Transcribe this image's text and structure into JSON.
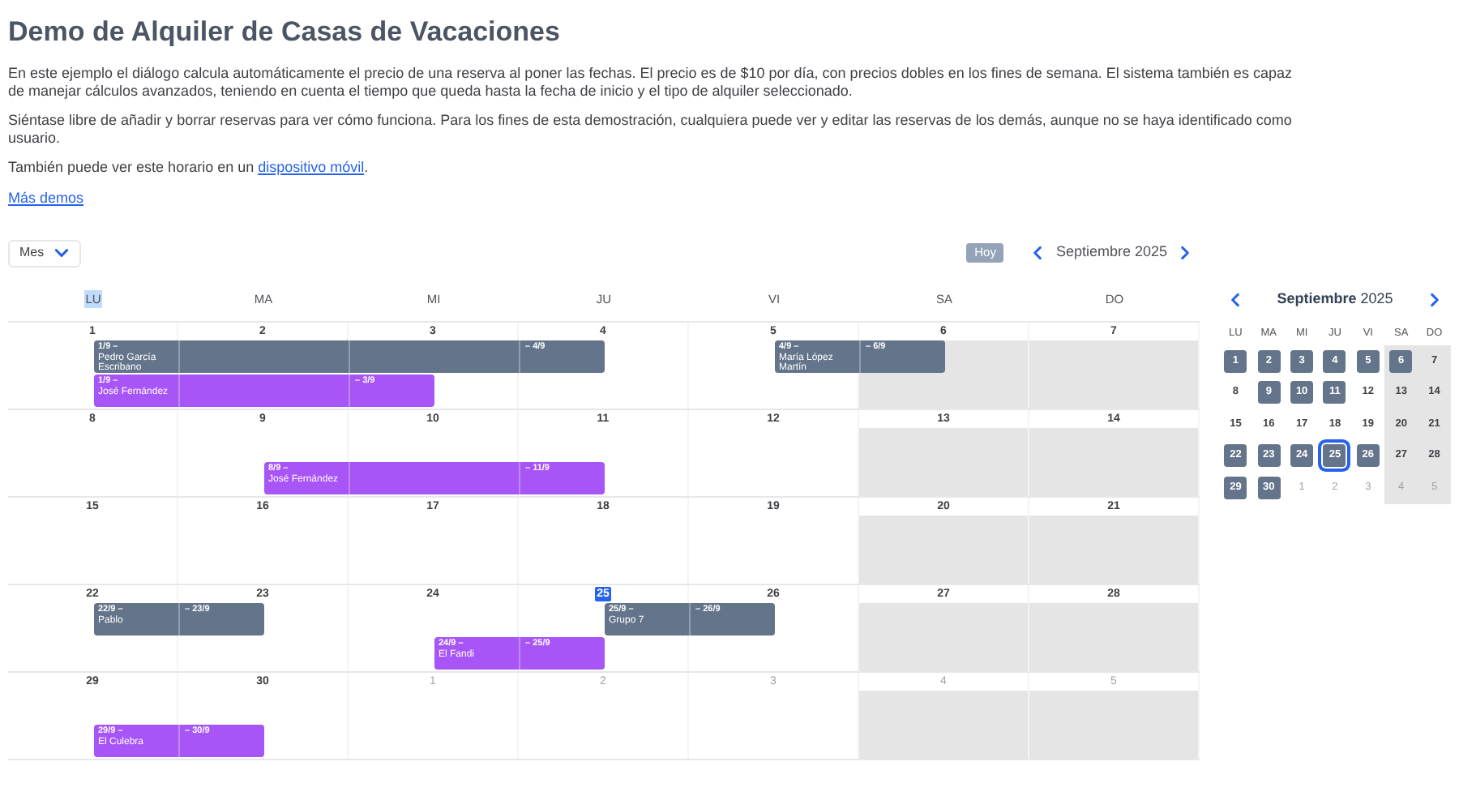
{
  "title": "Demo de Alquiler de Casas de Vacaciones",
  "paragraphs": [
    "En este ejemplo el diálogo calcula automáticamente el precio de una reserva al poner las fechas. El precio es de $10 por día, con precios dobles en los fines de semana. El sistema también es capaz de manejar cálculos avanzados, teniendo en cuenta el tiempo que queda hasta la fecha de inicio y el tipo de alquiler seleccionado.",
    "Siéntase libre de añadir y borrar reservas para ver cómo funciona. Para los fines de esta demostración, cualquiera puede ver y editar las reservas de los demás, aunque no se haya identificado como usuario."
  ],
  "mobile_note": {
    "text": "También puede ver este horario en un ",
    "link": "dispositivo móvil",
    "after": "."
  },
  "more_link": "Más demos",
  "toolbar": {
    "view": "Mes",
    "today": "Hoy",
    "month": "Septiembre 2025"
  },
  "weekdays": [
    {
      "label": "LU",
      "highlighted": true
    },
    {
      "label": "MA",
      "highlighted": false
    },
    {
      "label": "MI",
      "highlighted": false
    },
    {
      "label": "JU",
      "highlighted": false
    },
    {
      "label": "VI",
      "highlighted": false
    },
    {
      "label": "SA",
      "highlighted": false
    },
    {
      "label": "DO",
      "highlighted": false
    }
  ],
  "weeks": [
    {
      "days": [
        {
          "label": "1",
          "muted": false,
          "today": false
        },
        {
          "label": "2",
          "muted": false,
          "today": false
        },
        {
          "label": "3",
          "muted": false,
          "today": false
        },
        {
          "label": "4",
          "muted": false,
          "today": false
        },
        {
          "label": "5",
          "muted": false,
          "today": false
        },
        {
          "label": "6",
          "muted": false,
          "today": false
        },
        {
          "label": "7",
          "muted": false,
          "today": false
        }
      ],
      "lanes": [
        {
          "slots": [
            {
              "kind": "start",
              "date": "1/9 –",
              "name": "Pedro García Escribano",
              "color": "#64748b"
            },
            {
              "kind": "middle"
            },
            {
              "kind": "middle"
            },
            {
              "kind": "end",
              "date": "– 4/9"
            },
            {
              "kind": "start",
              "date": "4/9 –",
              "name": "María López Martín",
              "color": "#64748b"
            },
            {
              "kind": "end",
              "date": "– 6/9"
            },
            {
              "kind": "empty"
            }
          ]
        },
        {
          "slots": [
            {
              "kind": "start",
              "date": "1/9 –",
              "name": "José Fernández",
              "color": "#a855f7"
            },
            {
              "kind": "middle"
            },
            {
              "kind": "end",
              "date": "– 3/9"
            },
            {
              "kind": "empty"
            },
            {
              "kind": "empty"
            },
            {
              "kind": "empty"
            },
            {
              "kind": "empty"
            }
          ]
        }
      ]
    },
    {
      "days": [
        {
          "label": "8",
          "muted": false,
          "today": false
        },
        {
          "label": "9",
          "muted": false,
          "today": false
        },
        {
          "label": "10",
          "muted": false,
          "today": false
        },
        {
          "label": "11",
          "muted": false,
          "today": false
        },
        {
          "label": "12",
          "muted": false,
          "today": false
        },
        {
          "label": "13",
          "muted": false,
          "today": false
        },
        {
          "label": "14",
          "muted": false,
          "today": false
        }
      ],
      "lanes": [
        {
          "slots": [
            {
              "kind": "empty"
            },
            {
              "kind": "empty"
            },
            {
              "kind": "empty"
            },
            {
              "kind": "empty"
            },
            {
              "kind": "empty"
            },
            {
              "kind": "empty"
            },
            {
              "kind": "empty"
            }
          ]
        },
        {
          "slots": [
            {
              "kind": "empty"
            },
            {
              "kind": "start",
              "date": "8/9 –",
              "name": "José Fernández",
              "color": "#a855f7"
            },
            {
              "kind": "middle"
            },
            {
              "kind": "end",
              "date": "– 11/9"
            },
            {
              "kind": "empty"
            },
            {
              "kind": "empty"
            },
            {
              "kind": "empty"
            }
          ]
        }
      ]
    },
    {
      "days": [
        {
          "label": "15",
          "muted": false,
          "today": false
        },
        {
          "label": "16",
          "muted": false,
          "today": false
        },
        {
          "label": "17",
          "muted": false,
          "today": false
        },
        {
          "label": "18",
          "muted": false,
          "today": false
        },
        {
          "label": "19",
          "muted": false,
          "today": false
        },
        {
          "label": "20",
          "muted": false,
          "today": false
        },
        {
          "label": "21",
          "muted": false,
          "today": false
        }
      ]
    },
    {
      "days": [
        {
          "label": "22",
          "muted": false,
          "today": false
        },
        {
          "label": "23",
          "muted": false,
          "today": false
        },
        {
          "label": "24",
          "muted": false,
          "today": false
        },
        {
          "label": "25",
          "muted": false,
          "today": true
        },
        {
          "label": "26",
          "muted": false,
          "today": false
        },
        {
          "label": "27",
          "muted": false,
          "today": false
        },
        {
          "label": "28",
          "muted": false,
          "today": false
        }
      ],
      "lanes": [
        {
          "slots": [
            {
              "kind": "start",
              "date": "22/9 –",
              "name": "Pablo",
              "color": "#64748b"
            },
            {
              "kind": "end",
              "date": "– 23/9"
            },
            {
              "kind": "empty"
            },
            {
              "kind": "start",
              "date": "25/9 –",
              "name": "Grupo 7",
              "color": "#64748b"
            },
            {
              "kind": "end",
              "date": "– 26/9"
            },
            {
              "kind": "empty"
            },
            {
              "kind": "empty"
            }
          ]
        },
        {
          "slots": [
            {
              "kind": "empty"
            },
            {
              "kind": "empty"
            },
            {
              "kind": "start",
              "date": "24/9 –",
              "name": "El Fandi",
              "color": "#a855f7"
            },
            {
              "kind": "end",
              "date": "– 25/9"
            },
            {
              "kind": "empty"
            },
            {
              "kind": "empty"
            },
            {
              "kind": "empty"
            }
          ]
        }
      ]
    },
    {
      "days": [
        {
          "label": "29",
          "muted": false,
          "today": false
        },
        {
          "label": "30",
          "muted": false,
          "today": false
        },
        {
          "label": "1",
          "muted": true,
          "today": false
        },
        {
          "label": "2",
          "muted": true,
          "today": false
        },
        {
          "label": "3",
          "muted": true,
          "today": false
        },
        {
          "label": "4",
          "muted": true,
          "today": false
        },
        {
          "label": "5",
          "muted": true,
          "today": false
        }
      ],
      "lanes": [
        {
          "slots": [
            {
              "kind": "empty"
            },
            {
              "kind": "empty"
            },
            {
              "kind": "empty"
            },
            {
              "kind": "empty"
            },
            {
              "kind": "empty"
            },
            {
              "kind": "empty"
            },
            {
              "kind": "empty"
            }
          ]
        },
        {
          "slots": [
            {
              "kind": "start",
              "date": "29/9 –",
              "name": "El Culebra",
              "color": "#a855f7"
            },
            {
              "kind": "end",
              "date": "– 30/9"
            },
            {
              "kind": "empty"
            },
            {
              "kind": "empty"
            },
            {
              "kind": "empty"
            },
            {
              "kind": "empty"
            },
            {
              "kind": "empty"
            }
          ]
        }
      ]
    }
  ],
  "mini": {
    "month": "Septiembre",
    "year": "2025",
    "weekdays": [
      "LU",
      "MA",
      "MI",
      "JU",
      "VI",
      "SA",
      "DO"
    ],
    "days": [
      {
        "label": "1",
        "booked": true,
        "today": false,
        "muted": false
      },
      {
        "label": "2",
        "booked": true,
        "today": false,
        "muted": false
      },
      {
        "label": "3",
        "booked": true,
        "today": false,
        "muted": false
      },
      {
        "label": "4",
        "booked": true,
        "today": false,
        "muted": false
      },
      {
        "label": "5",
        "booked": true,
        "today": false,
        "muted": false
      },
      {
        "label": "6",
        "booked": true,
        "today": false,
        "muted": false
      },
      {
        "label": "7",
        "booked": false,
        "today": false,
        "muted": false
      },
      {
        "label": "8",
        "booked": false,
        "today": false,
        "muted": false
      },
      {
        "label": "9",
        "booked": true,
        "today": false,
        "muted": false
      },
      {
        "label": "10",
        "booked": true,
        "today": false,
        "muted": false
      },
      {
        "label": "11",
        "booked": true,
        "today": false,
        "muted": false
      },
      {
        "label": "12",
        "booked": false,
        "today": false,
        "muted": false
      },
      {
        "label": "13",
        "booked": false,
        "today": false,
        "muted": false
      },
      {
        "label": "14",
        "booked": false,
        "today": false,
        "muted": false
      },
      {
        "label": "15",
        "booked": false,
        "today": false,
        "muted": false
      },
      {
        "label": "16",
        "booked": false,
        "today": false,
        "muted": false
      },
      {
        "label": "17",
        "booked": false,
        "today": false,
        "muted": false
      },
      {
        "label": "18",
        "booked": false,
        "today": false,
        "muted": false
      },
      {
        "label": "19",
        "booked": false,
        "today": false,
        "muted": false
      },
      {
        "label": "20",
        "booked": false,
        "today": false,
        "muted": false
      },
      {
        "label": "21",
        "booked": false,
        "today": false,
        "muted": false
      },
      {
        "label": "22",
        "booked": true,
        "today": false,
        "muted": false
      },
      {
        "label": "23",
        "booked": true,
        "today": false,
        "muted": false
      },
      {
        "label": "24",
        "booked": true,
        "today": false,
        "muted": false
      },
      {
        "label": "25",
        "booked": true,
        "today": true,
        "muted": false
      },
      {
        "label": "26",
        "booked": true,
        "today": false,
        "muted": false
      },
      {
        "label": "27",
        "booked": false,
        "today": false,
        "muted": false
      },
      {
        "label": "28",
        "booked": false,
        "today": false,
        "muted": false
      },
      {
        "label": "29",
        "booked": true,
        "today": false,
        "muted": false
      },
      {
        "label": "30",
        "booked": true,
        "today": false,
        "muted": false
      },
      {
        "label": "1",
        "booked": false,
        "today": false,
        "muted": true
      },
      {
        "label": "2",
        "booked": false,
        "today": false,
        "muted": true
      },
      {
        "label": "3",
        "booked": false,
        "today": false,
        "muted": true
      },
      {
        "label": "4",
        "booked": false,
        "today": false,
        "muted": true
      },
      {
        "label": "5",
        "booked": false,
        "today": false,
        "muted": true
      }
    ]
  }
}
